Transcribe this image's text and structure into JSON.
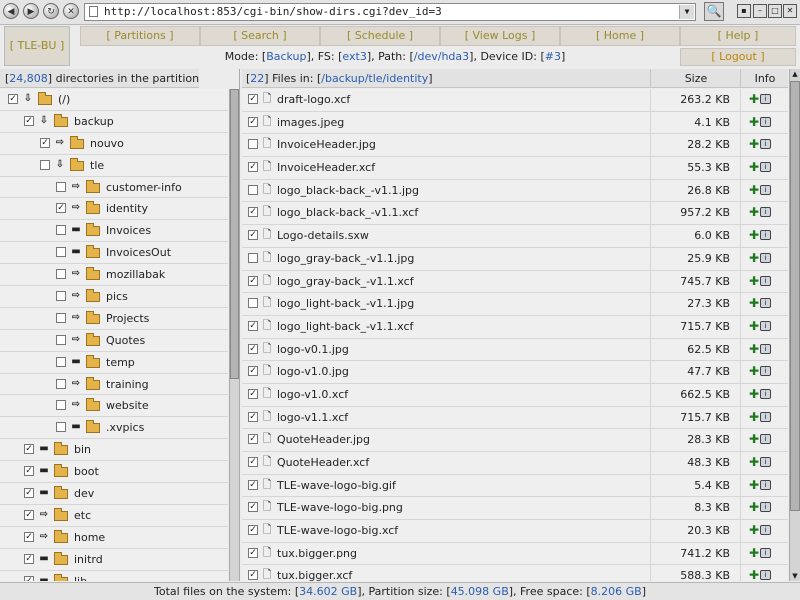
{
  "browser": {
    "url": "http://localhost:853/cgi-bin/show-dirs.cgi?dev_id=3",
    "back_glyph": "◀",
    "forward_glyph": "▶",
    "reload_glyph": "↻",
    "stop_glyph": "✕",
    "url_dropdown_glyph": "▼",
    "search_glyph": "🔍",
    "win_glyphs": [
      "▪",
      "–",
      "□",
      "✕"
    ]
  },
  "header": {
    "app_name": "[ TLE-BU ]",
    "nav": [
      "[ Partitions ]",
      "[ Search ]",
      "[ Schedule ]",
      "[ View Logs ]",
      "[ Home ]",
      "[ Help ]"
    ],
    "mode_label": "Mode: [",
    "mode_value": "Backup",
    "fs_label": "], FS: [",
    "fs_value": "ext3",
    "path_label": "], Path: [",
    "path_value": "/dev/hda3",
    "dev_label": "], Device ID: [",
    "dev_value": "#3",
    "mode_end": "]",
    "logout": "[ Logout ]"
  },
  "left": {
    "count_open": "[",
    "count": "24,808",
    "count_close": "] directories in the partition",
    "tree": [
      {
        "label": "(/)",
        "depth": 0,
        "checked": true,
        "exp": "down"
      },
      {
        "label": "backup",
        "depth": 1,
        "checked": true,
        "exp": "down"
      },
      {
        "label": "nouvo",
        "depth": 2,
        "checked": true,
        "exp": "right"
      },
      {
        "label": "tle",
        "depth": 2,
        "checked": false,
        "exp": "down"
      },
      {
        "label": "customer-info",
        "depth": 3,
        "checked": false,
        "exp": "right"
      },
      {
        "label": "identity",
        "depth": 3,
        "checked": true,
        "exp": "right"
      },
      {
        "label": "Invoices",
        "depth": 3,
        "checked": false,
        "exp": "none"
      },
      {
        "label": "InvoicesOut",
        "depth": 3,
        "checked": false,
        "exp": "none"
      },
      {
        "label": "mozillabak",
        "depth": 3,
        "checked": false,
        "exp": "right"
      },
      {
        "label": "pics",
        "depth": 3,
        "checked": false,
        "exp": "right"
      },
      {
        "label": "Projects",
        "depth": 3,
        "checked": false,
        "exp": "right"
      },
      {
        "label": "Quotes",
        "depth": 3,
        "checked": false,
        "exp": "right"
      },
      {
        "label": "temp",
        "depth": 3,
        "checked": false,
        "exp": "none"
      },
      {
        "label": "training",
        "depth": 3,
        "checked": false,
        "exp": "right"
      },
      {
        "label": "website",
        "depth": 3,
        "checked": false,
        "exp": "right"
      },
      {
        "label": ".xvpics",
        "depth": 3,
        "checked": false,
        "exp": "none"
      },
      {
        "label": "bin",
        "depth": 1,
        "checked": true,
        "exp": "none"
      },
      {
        "label": "boot",
        "depth": 1,
        "checked": true,
        "exp": "none"
      },
      {
        "label": "dev",
        "depth": 1,
        "checked": true,
        "exp": "none"
      },
      {
        "label": "etc",
        "depth": 1,
        "checked": true,
        "exp": "right"
      },
      {
        "label": "home",
        "depth": 1,
        "checked": true,
        "exp": "right"
      },
      {
        "label": "initrd",
        "depth": 1,
        "checked": true,
        "exp": "none"
      },
      {
        "label": "lib",
        "depth": 1,
        "checked": true,
        "exp": "none"
      }
    ]
  },
  "right": {
    "count_open": "[",
    "count": "22",
    "files_label": "] Files in: [",
    "dir_path": "/backup/tle/identity",
    "close": "]",
    "col_size": "Size",
    "col_info": "Info",
    "plus_glyph": "✚",
    "info_glyph": "i",
    "file_glyph": "🗋",
    "files": [
      {
        "name": "draft-logo.xcf",
        "size": "263.2 KB",
        "checked": true
      },
      {
        "name": "images.jpeg",
        "size": "4.1 KB",
        "checked": true
      },
      {
        "name": "InvoiceHeader.jpg",
        "size": "28.2 KB",
        "checked": false
      },
      {
        "name": "InvoiceHeader.xcf",
        "size": "55.3 KB",
        "checked": true
      },
      {
        "name": "logo_black-back_-v1.1.jpg",
        "size": "26.8 KB",
        "checked": false
      },
      {
        "name": "logo_black-back_-v1.1.xcf",
        "size": "957.2 KB",
        "checked": true
      },
      {
        "name": "Logo-details.sxw",
        "size": "6.0 KB",
        "checked": true
      },
      {
        "name": "logo_gray-back_-v1.1.jpg",
        "size": "25.9 KB",
        "checked": false
      },
      {
        "name": "logo_gray-back_-v1.1.xcf",
        "size": "745.7 KB",
        "checked": true
      },
      {
        "name": "logo_light-back_-v1.1.jpg",
        "size": "27.3 KB",
        "checked": false
      },
      {
        "name": "logo_light-back_-v1.1.xcf",
        "size": "715.7 KB",
        "checked": true
      },
      {
        "name": "logo-v0.1.jpg",
        "size": "62.5 KB",
        "checked": true
      },
      {
        "name": "logo-v1.0.jpg",
        "size": "47.7 KB",
        "checked": true
      },
      {
        "name": "logo-v1.0.xcf",
        "size": "662.5 KB",
        "checked": true
      },
      {
        "name": "logo-v1.1.xcf",
        "size": "715.7 KB",
        "checked": true
      },
      {
        "name": "QuoteHeader.jpg",
        "size": "28.3 KB",
        "checked": true
      },
      {
        "name": "QuoteHeader.xcf",
        "size": "48.3 KB",
        "checked": true
      },
      {
        "name": "TLE-wave-logo-big.gif",
        "size": "5.4 KB",
        "checked": true
      },
      {
        "name": "TLE-wave-logo-big.png",
        "size": "8.3 KB",
        "checked": true
      },
      {
        "name": "TLE-wave-logo-big.xcf",
        "size": "20.3 KB",
        "checked": true
      },
      {
        "name": "tux.bigger.png",
        "size": "741.2 KB",
        "checked": true
      },
      {
        "name": "tux.bigger.xcf",
        "size": "588.3 KB",
        "checked": true
      }
    ]
  },
  "footer": {
    "total_label": "Total files on the system: [",
    "total_value": "34.602 GB",
    "psize_label": "], Partition size: [",
    "psize_value": "45.098 GB",
    "free_label": "], Free space: [",
    "free_value": "8.206 GB",
    "end": "]"
  },
  "colors": {
    "link": "#2a5db0",
    "nav_text": "#9a8a2a",
    "logout_text": "#b8860b",
    "folder": "#e4b44b",
    "plus_green": "#1f7a1f"
  }
}
